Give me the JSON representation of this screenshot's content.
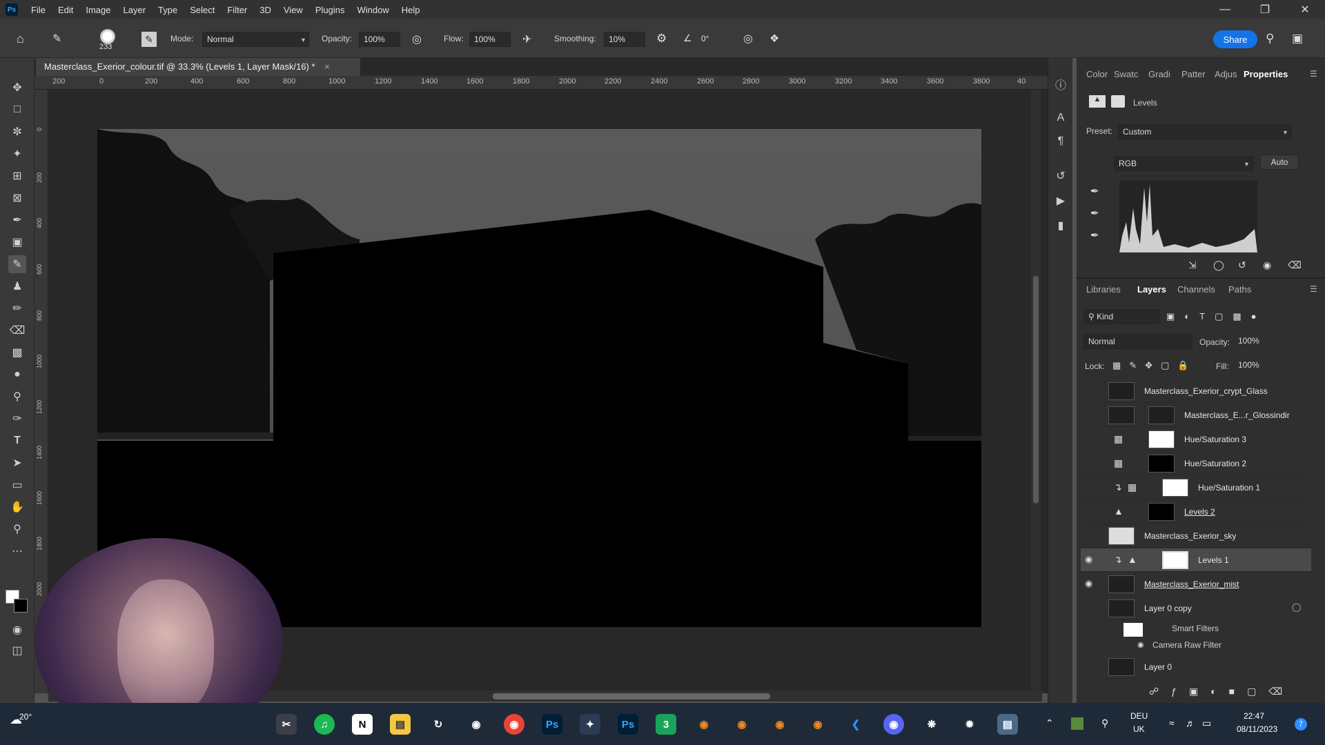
{
  "app": {
    "logo": "Ps"
  },
  "menu": [
    "File",
    "Edit",
    "Image",
    "Layer",
    "Type",
    "Select",
    "Filter",
    "3D",
    "View",
    "Plugins",
    "Window",
    "Help"
  ],
  "options": {
    "brush_size": "233",
    "mode_label": "Mode:",
    "mode_value": "Normal",
    "opacity_label": "Opacity:",
    "opacity_value": "100%",
    "flow_label": "Flow:",
    "flow_value": "100%",
    "smoothing_label": "Smoothing:",
    "smoothing_value": "10%",
    "angle_value": "0°",
    "share_label": "Share"
  },
  "document": {
    "tab_title": "Masterclass_Exerior_colour.tif @ 33.3% (Levels 1, Layer Mask/16) *",
    "close": "×"
  },
  "rulers": {
    "top": [
      "200",
      "0",
      "200",
      "400",
      "600",
      "800",
      "1000",
      "1200",
      "1400",
      "1600",
      "1800",
      "2000",
      "2200",
      "2400",
      "2600",
      "2800",
      "3000",
      "3200",
      "3400",
      "3600",
      "3800",
      "40"
    ],
    "left": [
      "0",
      "200",
      "400",
      "600",
      "800",
      "1000",
      "1200",
      "1400",
      "1600",
      "1800",
      "2000"
    ]
  },
  "properties_panel": {
    "tabs": [
      "Color",
      "Swatc",
      "Gradi",
      "Patter",
      "Adjus",
      "Properties"
    ],
    "active_tab": "Properties",
    "header": "Levels",
    "preset_label": "Preset:",
    "preset_value": "Custom",
    "channel_value": "RGB",
    "auto_label": "Auto"
  },
  "layers_panel": {
    "tabs": [
      "Libraries",
      "Layers",
      "Channels",
      "Paths"
    ],
    "active_tab": "Layers",
    "kind_label": "Kind",
    "blend_mode": "Normal",
    "opacity_label": "Opacity:",
    "opacity_value": "100%",
    "lock_label": "Lock:",
    "fill_label": "Fill:",
    "fill_value": "100%",
    "layers": [
      {
        "name": "Masterclass_Exerior_crypt_Glass",
        "visible": false,
        "selected": false
      },
      {
        "name": "Masterclass_E...r_Glossindir",
        "visible": false,
        "selected": false
      },
      {
        "name": "Hue/Saturation 3",
        "visible": false,
        "selected": false
      },
      {
        "name": "Hue/Saturation 2",
        "visible": false,
        "selected": false
      },
      {
        "name": "Hue/Saturation 1",
        "visible": false,
        "selected": false
      },
      {
        "name": "Levels 2",
        "visible": false,
        "selected": false
      },
      {
        "name": "Masterclass_Exerior_sky",
        "visible": false,
        "selected": false
      },
      {
        "name": "Levels 1",
        "visible": true,
        "selected": true
      },
      {
        "name": "Masterclass_Exerior_mist",
        "visible": true,
        "selected": false
      },
      {
        "name": "Layer 0 copy",
        "visible": false,
        "selected": false
      },
      {
        "name": "Smart Filters",
        "visible": true,
        "selected": false
      },
      {
        "name": "Camera Raw Filter",
        "visible": true,
        "selected": false
      },
      {
        "name": "Layer 0",
        "visible": false,
        "selected": false
      }
    ]
  },
  "taskbar": {
    "weather": "20°",
    "language_top": "DEU",
    "language_bottom": "UK",
    "time": "22:47",
    "date": "08/11/2023",
    "notification_count": "7"
  },
  "colors": {
    "accent": "#1473e6",
    "selected_layer": "#4a4a4a",
    "panel_bg": "#2f2f2f"
  }
}
